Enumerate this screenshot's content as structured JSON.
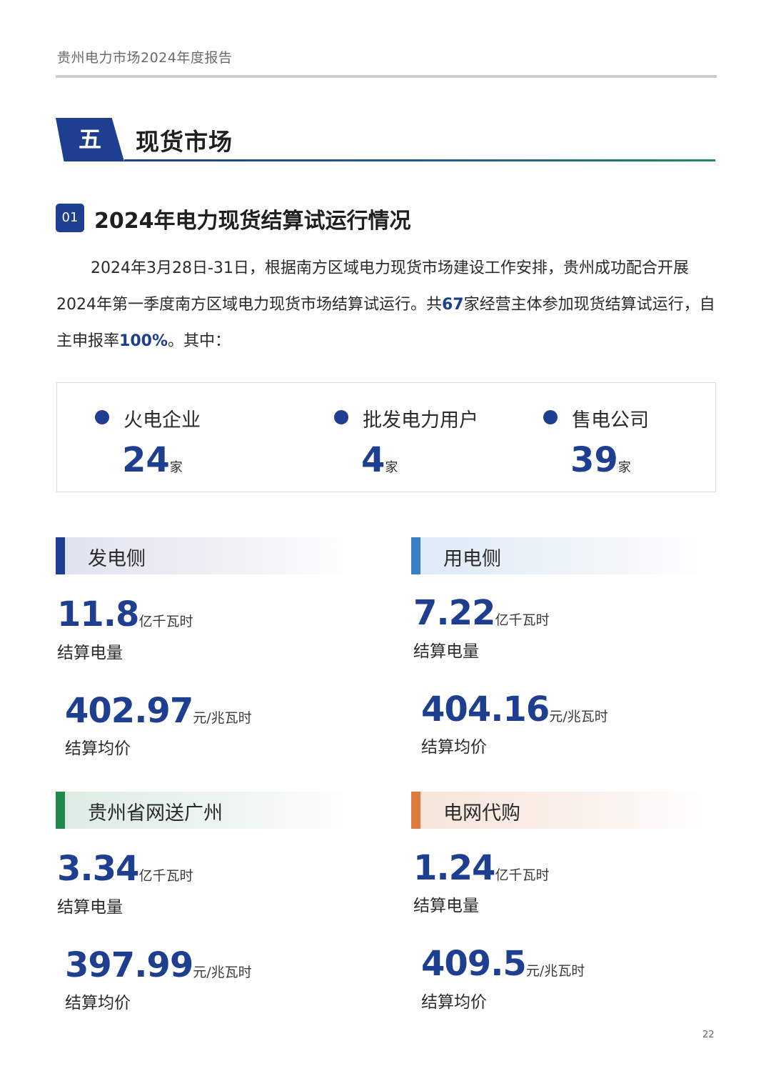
{
  "header": {
    "title": "贵州电力市场2024年度报告"
  },
  "section": {
    "number": "五",
    "title": "现货市场"
  },
  "subsection": {
    "number": "01",
    "title": "2024年电力现货结算试运行情况"
  },
  "intro": {
    "part1": "2024年3月28日-31日，根据南方区域电力现货市场建设工作安排，贵州成功配合开展2024年第一季度南方区域电力现货市场结算试运行。共",
    "entity_count": "67",
    "part2": "家经营主体参加现货结算试运行，自主申报率",
    "declare_rate": "100%",
    "part3": "。其中："
  },
  "participants": [
    {
      "label": "火电企业",
      "value": "24",
      "unit": "家"
    },
    {
      "label": "批发电力用户",
      "value": "4",
      "unit": "家"
    },
    {
      "label": "售电公司",
      "value": "39",
      "unit": "家"
    }
  ],
  "categories": [
    {
      "title": "发电侧",
      "color": "#1e3f8f",
      "energy": {
        "value": "11.8",
        "unit": "亿千瓦时",
        "label": "结算电量"
      },
      "price": {
        "value": "402.97",
        "unit": "元/兆瓦时",
        "label": "结算均价"
      }
    },
    {
      "title": "用电侧",
      "color": "#3a7fc4",
      "energy": {
        "value": "7.22",
        "unit": "亿千瓦时",
        "label": "结算电量"
      },
      "price": {
        "value": "404.16",
        "unit": "元/兆瓦时",
        "label": "结算均价"
      }
    },
    {
      "title": "贵州省网送广州",
      "color": "#1f8a4c",
      "energy": {
        "value": "3.34",
        "unit": "亿千瓦时",
        "label": "结算电量"
      },
      "price": {
        "value": "397.99",
        "unit": "元/兆瓦时",
        "label": "结算均价"
      }
    },
    {
      "title": "电网代购",
      "color": "#e07a3c",
      "energy": {
        "value": "1.24",
        "unit": "亿千瓦时",
        "label": "结算电量"
      },
      "price": {
        "value": "409.5",
        "unit": "元/兆瓦时",
        "label": "结算均价"
      }
    }
  ],
  "page_number": "22"
}
